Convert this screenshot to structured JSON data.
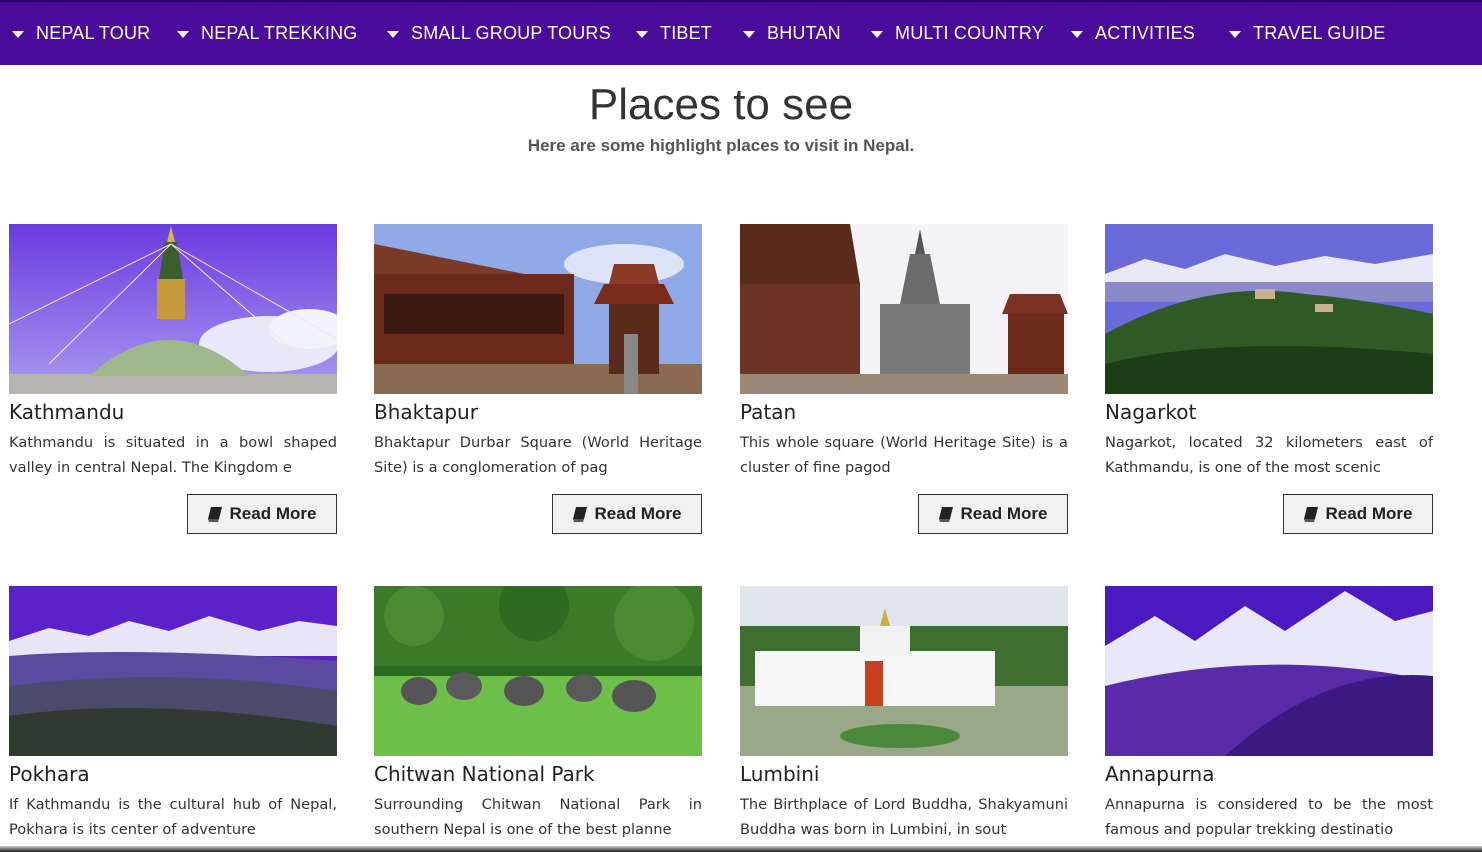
{
  "nav": {
    "items": [
      {
        "label": "NEPAL TOUR"
      },
      {
        "label": "NEPAL TREKKING"
      },
      {
        "label": "SMALL GROUP TOURS"
      },
      {
        "label": "TIBET"
      },
      {
        "label": "BHUTAN"
      },
      {
        "label": "MULTI COUNTRY"
      },
      {
        "label": "ACTIVITIES"
      },
      {
        "label": "TRAVEL GUIDE"
      }
    ],
    "background": "#4a0b9a"
  },
  "section": {
    "title": "Places to see",
    "subtitle": "Here are some highlight places to visit in Nepal."
  },
  "places": [
    {
      "name": "Kathmandu",
      "text": "Kathmandu is situated in a bowl shaped valley in central Nepal. The Kingdom e",
      "button": "Read More",
      "image": "boudhanath-stupa-photo"
    },
    {
      "name": "Bhaktapur",
      "text": "Bhaktapur Durbar Square (World Heritage Site) is a conglomeration of pag",
      "button": "Read More",
      "image": "bhaktapur-durbar-square-photo"
    },
    {
      "name": "Patan",
      "text": "This whole square  (World Heritage Site) is a cluster of fine pagod",
      "button": "Read More",
      "image": "patan-temples-photo"
    },
    {
      "name": "Nagarkot",
      "text": "Nagarkot, located 32 kilometers east of Kathmandu, is one of the most scenic",
      "button": "Read More",
      "image": "nagarkot-hills-photo"
    },
    {
      "name": "Pokhara",
      "text": "If Kathmandu is the cultural hub of Nepal, Pokhara is its center of adventure",
      "button": "Read More",
      "image": "pokhara-mountains-photo"
    },
    {
      "name": "Chitwan National Park",
      "text": "Surrounding Chitwan National Park in southern Nepal is one of the best planne",
      "button": "Read More",
      "image": "chitwan-elephants-photo"
    },
    {
      "name": "Lumbini",
      "text": "The Birthplace of Lord Buddha, Shakyamuni Buddha was born in Lumbini, in sout",
      "button": "Read More",
      "image": "lumbini-temple-photo"
    },
    {
      "name": "Annapurna",
      "text": "Annapurna is considered to be the most famous and popular trekking destinatio",
      "button": "Read More",
      "image": "annapurna-peaks-photo"
    }
  ]
}
